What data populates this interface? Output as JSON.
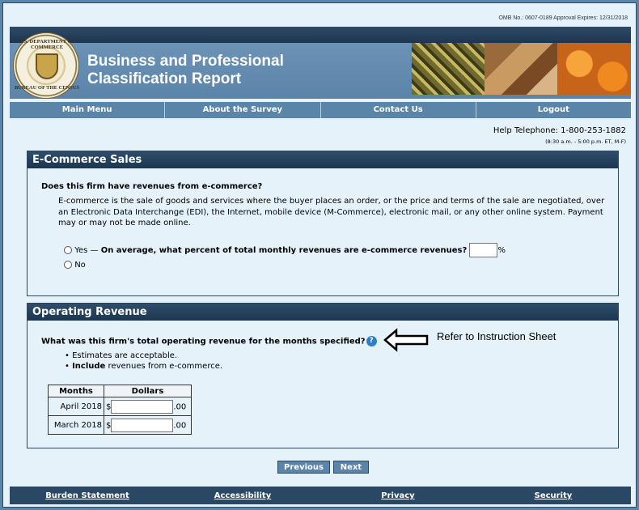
{
  "omb_notice": "OMB No.: 0607-0189  Approval Expires: 12/31/2018",
  "header": {
    "title_line1": "Business and Professional",
    "title_line2": "Classification Report",
    "seal_text_top": "U.S. DEPARTMENT OF COMMERCE",
    "seal_text_bottom": "BUREAU OF THE CENSUS"
  },
  "nav": {
    "items": [
      "Main Menu",
      "About the Survey",
      "Contact Us",
      "Logout"
    ]
  },
  "help": {
    "telephone": "Help Telephone: 1-800-253-1882",
    "hours": "(8:30 a.m. - 5:00 p.m. ET, M-F)"
  },
  "ecommerce": {
    "heading": "E-Commerce Sales",
    "question": "Does this firm have revenues from e-commerce?",
    "definition": "E-commerce is the sale of goods and services where the buyer places an order, or the price and terms of the sale are negotiated, over an Electronic Data Interchange (EDI), the Internet, mobile device (M-Commerce), electronic mail, or any other online system. Payment may or may not be made online.",
    "yes_label": "Yes —",
    "yes_followup": "On average, what percent of total monthly revenues are e-commerce revenues?",
    "percent_value": "",
    "percent_sign": "%",
    "no_label": "No"
  },
  "operating": {
    "heading": "Operating Revenue",
    "question": "What was this firm's total operating revenue for the months specified?",
    "annotation": "Refer to Instruction Sheet",
    "bullet1": "Estimates are acceptable.",
    "bullet2_bold": "Include",
    "bullet2_rest": " revenues from e-commerce.",
    "table": {
      "headers": [
        "Months",
        "Dollars"
      ],
      "rows": [
        {
          "month": "April 2018",
          "value": "",
          "cents": ".00"
        },
        {
          "month": "March 2018",
          "value": "",
          "cents": ".00"
        }
      ],
      "currency": "$"
    }
  },
  "buttons": {
    "previous": "Previous",
    "next": "Next"
  },
  "footer": {
    "links": [
      "Burden Statement",
      "Accessibility",
      "Privacy",
      "Security"
    ]
  }
}
